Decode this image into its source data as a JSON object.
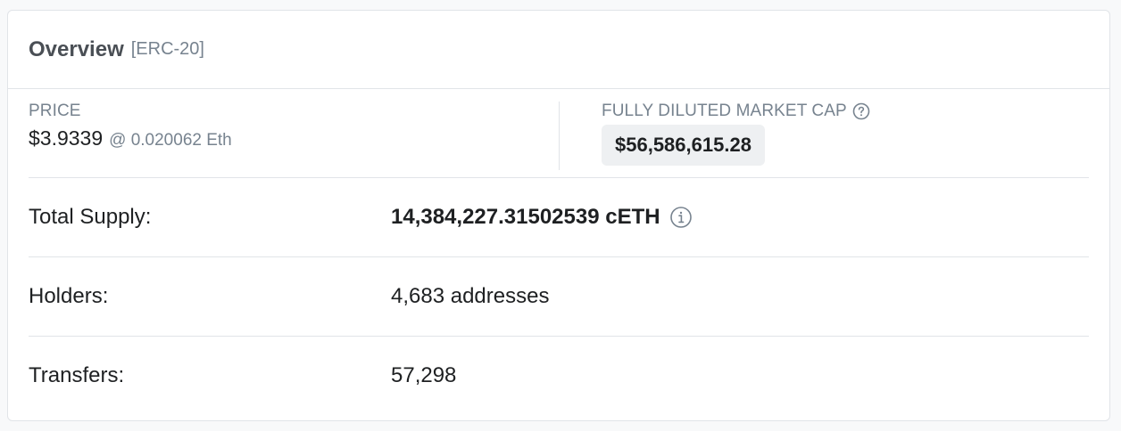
{
  "overview": {
    "title": "Overview",
    "token_standard": "[ERC-20]"
  },
  "price": {
    "label": "PRICE",
    "usd": "$3.9339",
    "eth": "@ 0.020062 Eth"
  },
  "market_cap": {
    "label": "FULLY DILUTED MARKET CAP",
    "value": "$56,586,615.28"
  },
  "total_supply": {
    "label": "Total Supply:",
    "value": "14,384,227.31502539 cETH"
  },
  "holders": {
    "label": "Holders:",
    "value": "4,683 addresses"
  },
  "transfers": {
    "label": "Transfers:",
    "value": "57,298"
  },
  "icons": {
    "market_cap_help": "question-circle-icon",
    "total_supply_info": "info-circle-icon"
  },
  "colors": {
    "text_primary": "#1e2022",
    "text_muted": "#77838f",
    "border": "#e1e4e8",
    "badge_bg": "#eef0f2"
  }
}
